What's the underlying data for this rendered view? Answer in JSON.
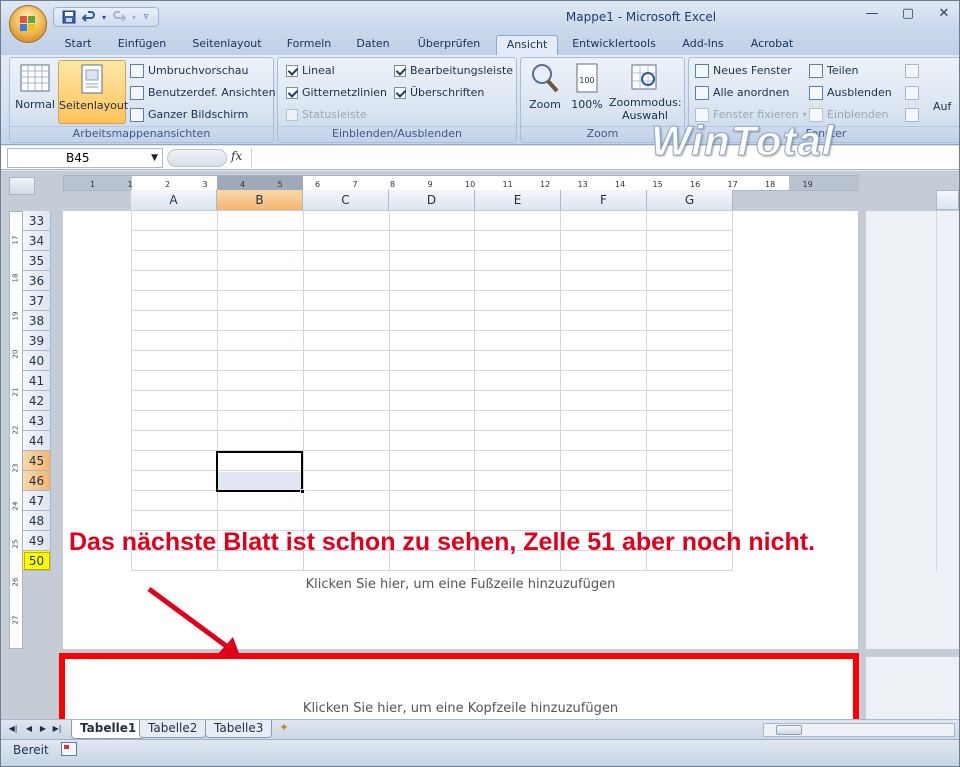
{
  "window": {
    "title": "Mappe1 - Microsoft Excel",
    "controls": [
      "minimize",
      "maximize",
      "close"
    ]
  },
  "quick_access": {
    "items": [
      "save-icon",
      "undo-icon",
      "redo-icon",
      "customize-icon"
    ]
  },
  "tabs": [
    {
      "label": "Start",
      "active": false
    },
    {
      "label": "Einfügen",
      "active": false
    },
    {
      "label": "Seitenlayout",
      "active": false
    },
    {
      "label": "Formeln",
      "active": false
    },
    {
      "label": "Daten",
      "active": false
    },
    {
      "label": "Überprüfen",
      "active": false
    },
    {
      "label": "Ansicht",
      "active": true
    },
    {
      "label": "Entwicklertools",
      "active": false
    },
    {
      "label": "Add-Ins",
      "active": false
    },
    {
      "label": "Acrobat",
      "active": false
    }
  ],
  "ribbon": {
    "group_arbeitsmappen": {
      "label": "Arbeitsmappenansichten",
      "normal": "Normal",
      "seitenlayout": "Seitenlayout",
      "umbruchvorschau": "Umbruchvorschau",
      "benutzerdef": "Benutzerdef. Ansichten",
      "ganzer_bildschirm": "Ganzer Bildschirm"
    },
    "group_einblenden": {
      "label": "Einblenden/Ausblenden",
      "lineal": "Lineal",
      "gitternetzlinien": "Gitternetzlinien",
      "statusleiste": "Statusleiste",
      "bearbeitungsleiste": "Bearbeitungsleiste",
      "ueberschriften": "Überschriften"
    },
    "group_zoom": {
      "label": "Zoom",
      "zoom": "Zoom",
      "hundred": "100%",
      "zoommodus_line1": "Zoommodus:",
      "zoommodus_line2": "Auswahl"
    },
    "group_fenster": {
      "label": "Fenster",
      "neues_fenster": "Neues Fenster",
      "alle_anordnen": "Alle anordnen",
      "fenster_fixieren": "Fenster fixieren",
      "teilen": "Teilen",
      "ausblenden": "Ausblenden",
      "einblenden": "Einblenden",
      "auf": "Auf"
    }
  },
  "formula_bar": {
    "name_box": "B45",
    "fx": "fx",
    "value": ""
  },
  "watermark": "WinTotal",
  "ruler": {
    "h_ticks": [
      "1",
      "1",
      "2",
      "3",
      "4",
      "5",
      "6",
      "7",
      "8",
      "9",
      "10",
      "11",
      "12",
      "13",
      "14",
      "15",
      "16",
      "17",
      "18",
      "19"
    ],
    "v_ticks": [
      "17",
      "18",
      "19",
      "20",
      "21",
      "22",
      "23",
      "24",
      "25",
      "26",
      "27"
    ]
  },
  "columns": [
    "A",
    "B",
    "C",
    "D",
    "E",
    "F",
    "G"
  ],
  "selected_column": "B",
  "rows": [
    "33",
    "34",
    "35",
    "36",
    "37",
    "38",
    "39",
    "40",
    "41",
    "42",
    "43",
    "44",
    "45",
    "46",
    "47",
    "48",
    "49",
    "50"
  ],
  "selected_rows": [
    "45",
    "46"
  ],
  "highlighted_row": "50",
  "page": {
    "footer_hint": "Klicken Sie hier, um eine Fußzeile hinzuzufügen",
    "header_hint": "Klicken Sie hier, um eine Kopfzeile hinzuzufügen"
  },
  "annotation": {
    "text": "Das nächste Blatt ist schon zu sehen, Zelle 51 aber noch nicht.",
    "color": "#e0001b",
    "box_color": "#ff0000"
  },
  "sheets": [
    {
      "label": "Tabelle1",
      "active": true
    },
    {
      "label": "Tabelle2",
      "active": false
    },
    {
      "label": "Tabelle3",
      "active": false
    }
  ],
  "status": {
    "text": "Bereit"
  }
}
